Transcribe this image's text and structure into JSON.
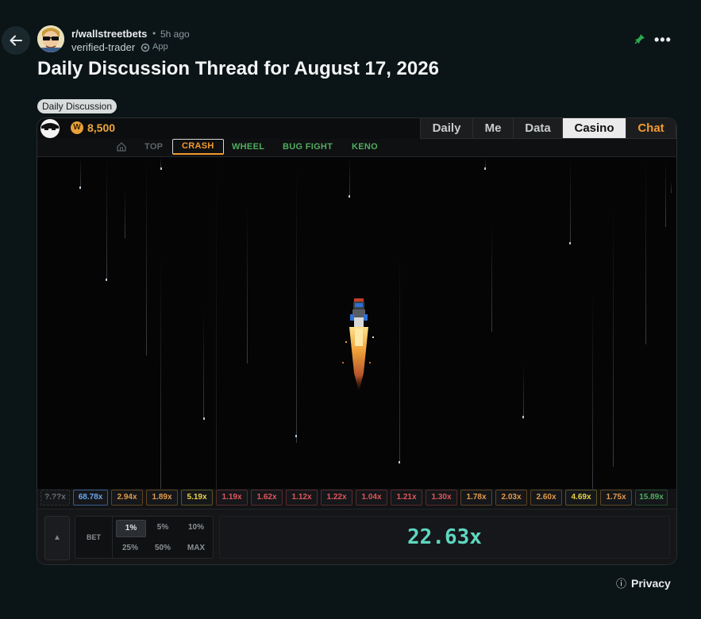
{
  "post": {
    "subreddit": "r/wallstreetbets",
    "separator": "•",
    "time_ago": "5h ago",
    "username": "verified-trader",
    "app_badge": "App",
    "title": "Daily Discussion Thread for August 17, 2026",
    "flair": "Daily Discussion",
    "more_label": "•••"
  },
  "widget": {
    "coin_symbol": "W",
    "balance": "8,500",
    "tabs": [
      "Daily",
      "Me",
      "Data",
      "Casino",
      "Chat"
    ],
    "active_tab": "Casino",
    "games": [
      "TOP",
      "CRASH",
      "WHEEL",
      "BUG FIGHT",
      "KENO"
    ],
    "active_game": "CRASH",
    "history": [
      {
        "value": "?.??x",
        "color": "#6b6f73"
      },
      {
        "value": "68.78x",
        "color": "#6aa7ef"
      },
      {
        "value": "2.94x",
        "color": "#e39a4c"
      },
      {
        "value": "1.89x",
        "color": "#e39a4c"
      },
      {
        "value": "5.19x",
        "color": "#e7d24a"
      },
      {
        "value": "1.19x",
        "color": "#e0565a"
      },
      {
        "value": "1.62x",
        "color": "#e0565a"
      },
      {
        "value": "1.12x",
        "color": "#e0565a"
      },
      {
        "value": "1.22x",
        "color": "#e0565a"
      },
      {
        "value": "1.04x",
        "color": "#e0565a"
      },
      {
        "value": "1.21x",
        "color": "#e0565a"
      },
      {
        "value": "1.30x",
        "color": "#e0565a"
      },
      {
        "value": "1.78x",
        "color": "#e39a4c"
      },
      {
        "value": "2.03x",
        "color": "#e39a4c"
      },
      {
        "value": "2.60x",
        "color": "#e39a4c"
      },
      {
        "value": "4.69x",
        "color": "#e7d24a"
      },
      {
        "value": "1.75x",
        "color": "#e39a4c"
      },
      {
        "value": "15.89x",
        "color": "#4fae5e"
      }
    ],
    "bet_label": "BET",
    "bet_options": [
      "1%",
      "5%",
      "10%",
      "25%",
      "50%",
      "MAX"
    ],
    "active_bet": "1%",
    "up_arrow": "▲",
    "multiplier": "22.63x"
  },
  "footer": {
    "privacy": "Privacy",
    "info_icon": "ⓘ"
  },
  "colors": {
    "background": "#0b1416",
    "accent_orange": "#f39a2e",
    "multiplier": "#5fd6c0",
    "green_nav": "#4fae5e"
  }
}
